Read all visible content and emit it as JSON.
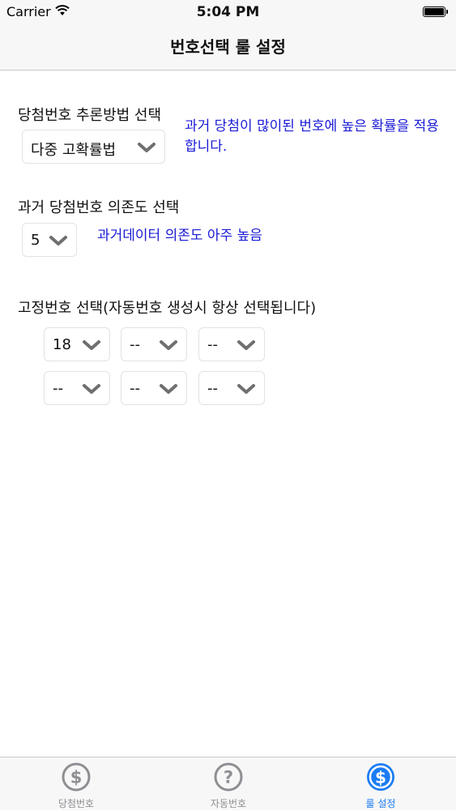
{
  "status_bar": {
    "carrier": "Carrier",
    "time": "5:04 PM"
  },
  "nav": {
    "title": "번호선택 룰 설정"
  },
  "method": {
    "label": "당첨번호 추론방법 선택",
    "selected": "다중 고확률법",
    "description": "과거 당첨이 많이된 번호에 높은 확률을 적용합니다."
  },
  "dependency": {
    "label": "과거 당첨번호 의존도 선택",
    "selected": "5",
    "description": "과거데이터 의존도 아주 높음"
  },
  "fixed": {
    "label": "고정번호 선택(자동번호 생성시 항상 선택됩니다)",
    "values": [
      "18",
      "--",
      "--",
      "--",
      "--",
      "--"
    ]
  },
  "tabs": [
    {
      "label": "당첨번호",
      "icon": "dollar-icon",
      "active": false
    },
    {
      "label": "자동번호",
      "icon": "question-icon",
      "active": false
    },
    {
      "label": "룰 설정",
      "icon": "dollar-icon",
      "active": true
    }
  ],
  "colors": {
    "accent": "#1a7cf2",
    "description": "#1a1ad6",
    "inactive": "#8e8e93"
  }
}
